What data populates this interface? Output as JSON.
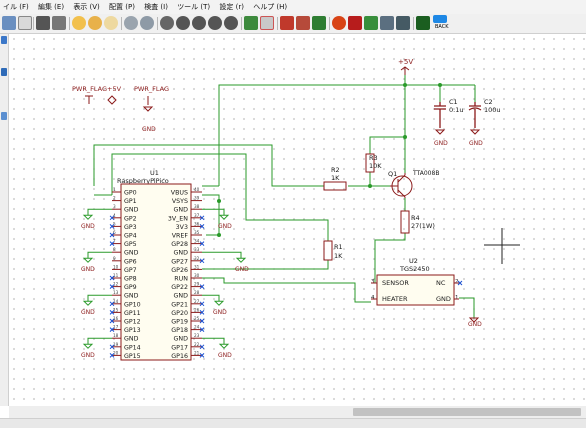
{
  "menubar": {
    "items": [
      "イル (F)",
      "編集 (E)",
      "表示 (V)",
      "配置 (P)",
      "検査 (I)",
      "ツール (T)",
      "設定 (r)",
      "ヘルプ (H)"
    ]
  },
  "toolbar": {
    "back_label": "BACK"
  },
  "schematic": {
    "pwr_flag1": "PWR_FLAG",
    "plus5v_1": "+5V",
    "pwr_flag2": "PWR_FLAG",
    "gnd": "GND",
    "plus5v_2": "+5V",
    "c1": {
      "ref": "C1",
      "value": "0.1u"
    },
    "c2": {
      "ref": "C2",
      "value": "100u"
    },
    "r3": {
      "ref": "R3",
      "value": "10K"
    },
    "r2": {
      "ref": "R2",
      "value": "1K"
    },
    "q1": {
      "ref": "Q1",
      "value": "TTA008B"
    },
    "r4": {
      "ref": "R4",
      "value": "27(1W)"
    },
    "r1": {
      "ref": "R1",
      "value": "1K"
    },
    "u1": {
      "ref": "U1",
      "value": "RaspberryPiPico"
    },
    "u1_left": [
      "GP0",
      "GP1",
      "GND",
      "GP2",
      "GP3",
      "GP4",
      "GP5",
      "GND",
      "GP6",
      "GP7",
      "GP8",
      "GP9",
      "GND",
      "GP10",
      "GP11",
      "GP12",
      "GP13",
      "GND",
      "GP14",
      "GP15"
    ],
    "u1_right": [
      "VBUS",
      "VSYS",
      "GND",
      "3V_EN",
      "3V3",
      "VREF",
      "GP28",
      "GND",
      "GP27",
      "GP26",
      "RUN",
      "GP22",
      "GND",
      "GP21",
      "GP20",
      "GP19",
      "GP18",
      "GND",
      "GP17",
      "GP16"
    ],
    "u1_left_nums": [
      "1",
      "2",
      "3",
      "4",
      "5",
      "6",
      "7",
      "8",
      "9",
      "10",
      "11",
      "12",
      "13",
      "14",
      "15",
      "16",
      "17",
      "18",
      "19",
      "20"
    ],
    "u1_right_nums": [
      "40",
      "39",
      "38",
      "37",
      "36",
      "35",
      "34",
      "33",
      "32",
      "31",
      "30",
      "29",
      "28",
      "27",
      "26",
      "25",
      "24",
      "23",
      "22",
      "21"
    ],
    "u2": {
      "ref": "U2",
      "value": "TGS2450"
    },
    "u2_sensor": "SENSOR",
    "u2_nc": "NC",
    "u2_heater": "HEATER",
    "u2_gnd": "GND",
    "u2_pin3": "3",
    "u2_pin2": "2",
    "u2_pin4": "4",
    "u2_pin1": "1"
  }
}
